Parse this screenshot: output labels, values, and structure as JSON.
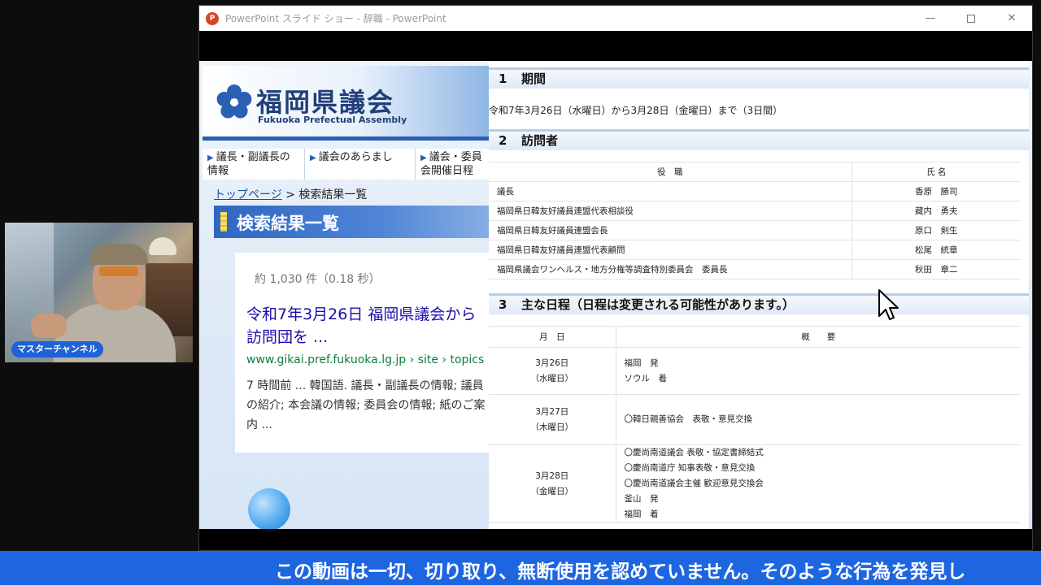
{
  "webcam": {
    "channel_badge": "マスターチャンネル"
  },
  "window": {
    "app_icon_text": "P",
    "title": "PowerPoint スライド ショー - 辞職 - PowerPoint",
    "minimize_glyph": "—",
    "close_glyph": "✕"
  },
  "website": {
    "title": "福岡県議会",
    "subtitle": "Fukuoka Prefectual Assembly",
    "nav": [
      {
        "label": "議長・副議長の情報"
      },
      {
        "label": "議会のあらまし"
      },
      {
        "label": "議会・委員会開催日程"
      }
    ],
    "breadcrumb": {
      "link": "トップページ",
      "separator": " > ",
      "current": "検索結果一覧"
    },
    "heading": "検索結果一覧",
    "result_count": "約 1,030 件（0.18 秒）",
    "result": {
      "title": "令和7年3月26日 福岡県議会から訪問団を ...",
      "url": "www.gikai.pref.fukuoka.lg.jp › site › topics",
      "snippet": "7 時間前 ... 韓国語. 議長・副議長の情報; 議員の紹介; 本会議の情報; 委員会の情報; 紙のご案内 ..."
    }
  },
  "document": {
    "sections": [
      {
        "num": "1",
        "title": "期間"
      },
      {
        "num": "2",
        "title": "訪問者"
      },
      {
        "num": "3",
        "title": "主な日程（日程は変更される可能性があります。）"
      }
    ],
    "period": "令和7年3月26日（水曜日）から3月28日（金曜日）まで（3日間）",
    "visitors": {
      "headers": {
        "role": "役　職",
        "name": "氏 名"
      },
      "rows": [
        {
          "role": "議長",
          "name": "香原　勝司"
        },
        {
          "role": "福岡県日韓友好議員連盟代表相談役",
          "name": "藏内　勇夫"
        },
        {
          "role": "福岡県日韓友好議員連盟会長",
          "name": "原口　剣生"
        },
        {
          "role": "福岡県日韓友好議員連盟代表顧問",
          "name": "松尾　統章"
        },
        {
          "role": "福岡県議会ワンヘルス・地方分権等調査特別委員会　委員長",
          "name": "秋田　章二"
        }
      ]
    },
    "schedule": {
      "headers": {
        "date": "月　日",
        "summary": "概　　要"
      },
      "rows": [
        {
          "date": "3月26日",
          "weekday": "（水曜日）",
          "lines": [
            "福岡　発",
            "ソウル　着"
          ]
        },
        {
          "date": "3月27日",
          "weekday": "（木曜日）",
          "lines": [
            "〇韓日親善協会　表敬・意見交換"
          ]
        },
        {
          "date": "3月28日",
          "weekday": "（金曜日）",
          "lines": [
            "〇慶尚南道議会 表敬・協定書締結式",
            "〇慶尚南道庁 知事表敬・意見交換",
            "〇慶尚南道議会主催 歓迎意見交換会",
            "釜山　発",
            "福岡　着"
          ]
        }
      ]
    }
  },
  "banner": {
    "text": "この動画は一切、切り取り、無断使用を認めていません。そのような行為を発見し"
  },
  "colors": {
    "banner_bg": "#1e66e0",
    "site_blue": "#2b5fb3",
    "link_blue": "#1a0dab",
    "url_green": "#0d7d3e"
  }
}
